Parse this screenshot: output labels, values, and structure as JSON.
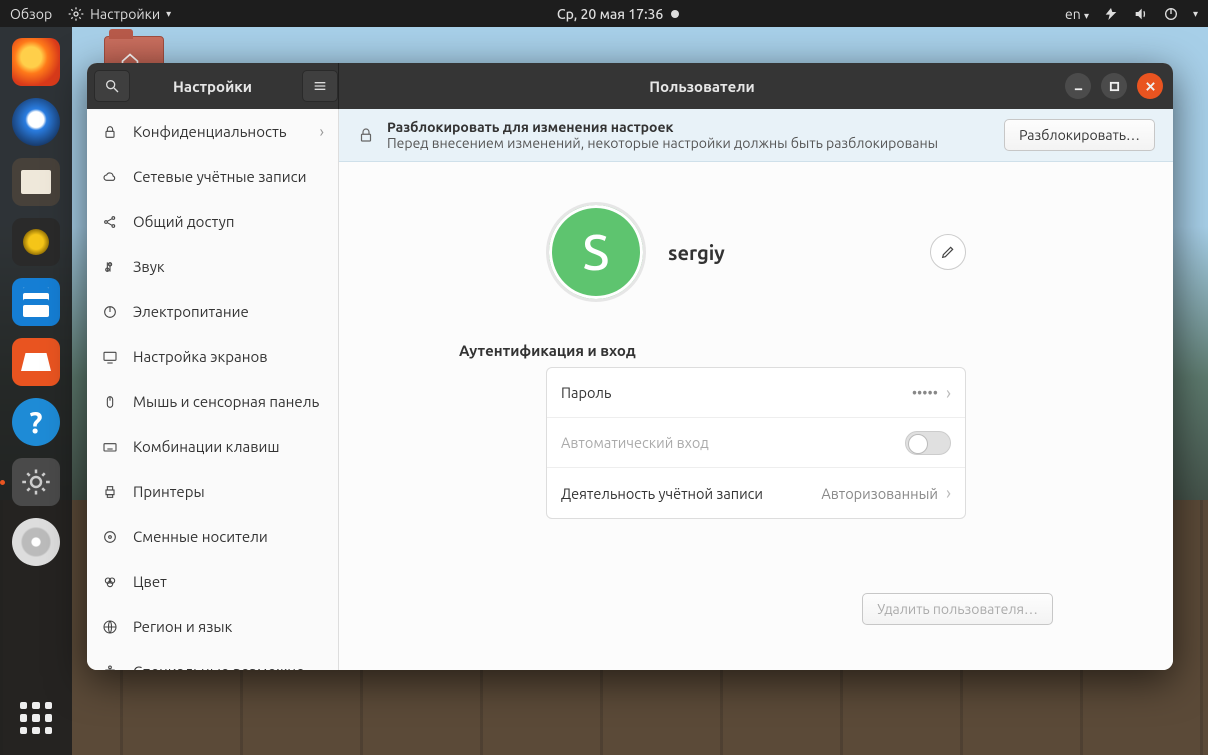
{
  "topbar": {
    "activities": "Обзор",
    "app_name": "Настройки",
    "clock": "Ср, 20 мая  17:36",
    "lang": "en"
  },
  "window": {
    "title_left": "Настройки",
    "title_right": "Пользователи"
  },
  "sidebar": {
    "items": [
      {
        "icon": "lock",
        "label": "Конфиденциальность",
        "chevron": true
      },
      {
        "icon": "cloud",
        "label": "Сетевые учётные записи",
        "chevron": false
      },
      {
        "icon": "share",
        "label": "Общий доступ",
        "chevron": false
      },
      {
        "icon": "sound",
        "label": "Звук",
        "chevron": false
      },
      {
        "icon": "power",
        "label": "Электропитание",
        "chevron": false
      },
      {
        "icon": "display",
        "label": "Настройка экранов",
        "chevron": false
      },
      {
        "icon": "mouse",
        "label": "Мышь и сенсорная панель",
        "chevron": false
      },
      {
        "icon": "keyboard",
        "label": "Комбинации клавиш",
        "chevron": false
      },
      {
        "icon": "printer",
        "label": "Принтеры",
        "chevron": false
      },
      {
        "icon": "media",
        "label": "Сменные носители",
        "chevron": false
      },
      {
        "icon": "color",
        "label": "Цвет",
        "chevron": false
      },
      {
        "icon": "region",
        "label": "Регион и язык",
        "chevron": false
      },
      {
        "icon": "a11y",
        "label": "Специальные возможности",
        "chevron": false
      }
    ]
  },
  "infobar": {
    "title": "Разблокировать для изменения настроек",
    "subtitle": "Перед внесением изменений, некоторые настройки должны быть разблокированы",
    "button": "Разблокировать…"
  },
  "user": {
    "name": "sergiy",
    "initial": "S"
  },
  "auth": {
    "section_title": "Аутентификация и вход",
    "rows": [
      {
        "label": "Пароль",
        "value": "•••••",
        "type": "nav"
      },
      {
        "label": "Автоматический вход",
        "type": "switch",
        "dim": true
      },
      {
        "label": "Деятельность учётной записи",
        "value": "Авторизованный",
        "type": "nav"
      }
    ]
  },
  "actions": {
    "delete_user": "Удалить пользователя…"
  }
}
